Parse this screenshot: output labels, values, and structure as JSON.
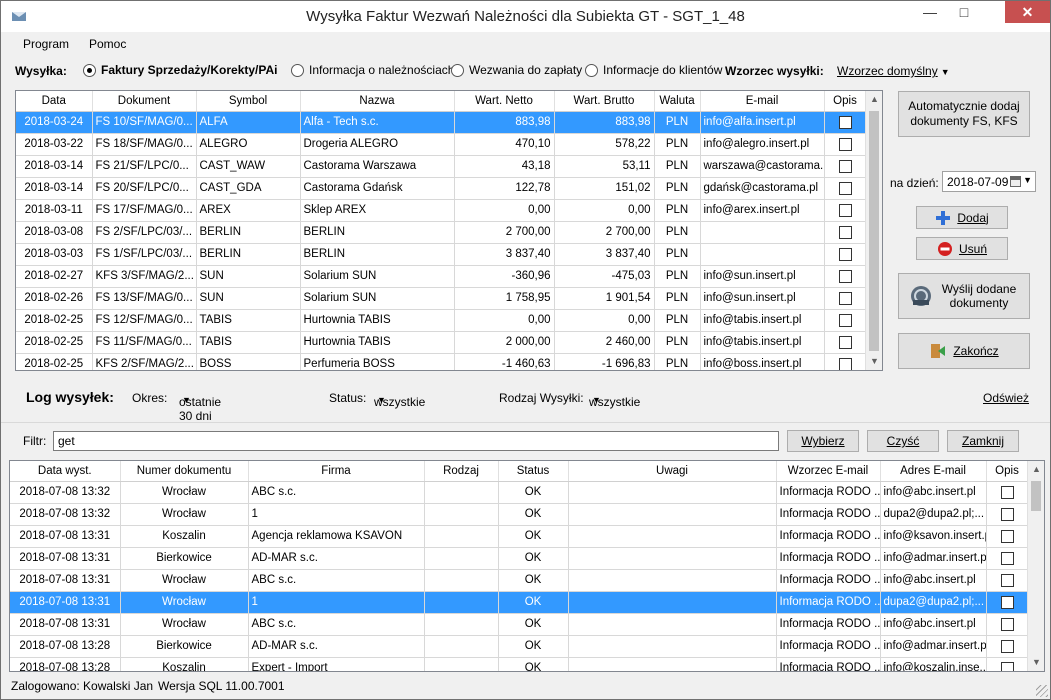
{
  "window": {
    "title": "Wysyłka Faktur Wezwań Należności dla Subiekta GT - SGT_1_48"
  },
  "menu": {
    "program": "Program",
    "pomoc": "Pomoc"
  },
  "wysylka": {
    "label": "Wysyłka:",
    "options": [
      "Faktury Sprzedaży/Korekty/PAi",
      "Informacja o należnościach",
      "Wezwania do zapłaty",
      "Informacje do klientów"
    ],
    "selected": 0,
    "wzorzec_label": "Wzorzec wysyłki:",
    "wzorzec_value": "Wzorzec domyślny"
  },
  "documents": {
    "columns": [
      "Data",
      "Dokument",
      "Symbol",
      "Nazwa",
      "Wart. Netto",
      "Wart. Brutto",
      "Waluta",
      "E-mail",
      "Opis"
    ],
    "rows": [
      [
        "2018-03-24",
        "FS 10/SF/MAG/0...",
        "ALFA",
        "Alfa - Tech s.c.",
        "883,98",
        "883,98",
        "PLN",
        "info@alfa.insert.pl"
      ],
      [
        "2018-03-22",
        "FS 18/SF/MAG/0...",
        "ALEGRO",
        "Drogeria ALEGRO",
        "470,10",
        "578,22",
        "PLN",
        "info@alegro.insert.pl"
      ],
      [
        "2018-03-14",
        "FS 21/SF/LPC/0...",
        "CAST_WAW",
        "Castorama Warszawa",
        "43,18",
        "53,11",
        "PLN",
        "warszawa@castorama..."
      ],
      [
        "2018-03-14",
        "FS 20/SF/LPC/0...",
        "CAST_GDA",
        "Castorama Gdańsk",
        "122,78",
        "151,02",
        "PLN",
        "gdańsk@castorama.pl"
      ],
      [
        "2018-03-11",
        "FS 17/SF/MAG/0...",
        "AREX",
        "Sklep AREX",
        "0,00",
        "0,00",
        "PLN",
        "info@arex.insert.pl"
      ],
      [
        "2018-03-08",
        "FS 2/SF/LPC/03/...",
        "BERLIN",
        "BERLIN",
        "2 700,00",
        "2 700,00",
        "PLN",
        ""
      ],
      [
        "2018-03-03",
        "FS 1/SF/LPC/03/...",
        "BERLIN",
        "BERLIN",
        "3 837,40",
        "3 837,40",
        "PLN",
        ""
      ],
      [
        "2018-02-27",
        "KFS 3/SF/MAG/2...",
        "SUN",
        "Solarium SUN",
        "-360,96",
        "-475,03",
        "PLN",
        "info@sun.insert.pl"
      ],
      [
        "2018-02-26",
        "FS 13/SF/MAG/0...",
        "SUN",
        "Solarium SUN",
        "1 758,95",
        "1 901,54",
        "PLN",
        "info@sun.insert.pl"
      ],
      [
        "2018-02-25",
        "FS 12/SF/MAG/0...",
        "TABIS",
        "Hurtownia TABIS",
        "0,00",
        "0,00",
        "PLN",
        "info@tabis.insert.pl"
      ],
      [
        "2018-02-25",
        "FS 11/SF/MAG/0...",
        "TABIS",
        "Hurtownia TABIS",
        "2 000,00",
        "2 460,00",
        "PLN",
        "info@tabis.insert.pl"
      ],
      [
        "2018-02-25",
        "KFS 2/SF/MAG/2...",
        "BOSS",
        "Perfumeria BOSS",
        "-1 460,63",
        "-1 696,83",
        "PLN",
        "info@boss.insert.pl"
      ]
    ],
    "selected_row": 0
  },
  "side": {
    "auto_add": "Automatycznie dodaj dokumenty FS, KFS",
    "na_dzien_label": "na dzień:",
    "date": "2018-07-09",
    "dodaj": "Dodaj",
    "usun": "Usuń",
    "wyslij": "Wyślij dodane dokumenty",
    "zakoncz": "Zakończ"
  },
  "log": {
    "title": "Log wysyłek:",
    "okres_label": "Okres:",
    "okres_value": "ostatnie 30 dni",
    "status_label": "Status:",
    "status_value": "wszystkie",
    "rodzaj_label": "Rodzaj Wysyłki:",
    "rodzaj_value": "wszystkie",
    "odswiez": "Odśwież"
  },
  "filter": {
    "label": "Filtr:",
    "value": "get",
    "wybierz": "Wybierz",
    "czysc": "Czyść",
    "zamknij": "Zamknij"
  },
  "logtable": {
    "columns": [
      "Data wyst.",
      "Numer dokumentu",
      "Firma",
      "Rodzaj",
      "Status",
      "Uwagi",
      "Wzorzec E-mail",
      "Adres E-mail",
      "Opis"
    ],
    "rows": [
      [
        "2018-07-08 13:32",
        "Wrocław",
        "ABC s.c.",
        "",
        "OK",
        "",
        "Informacja RODO ...",
        "info@abc.insert.pl"
      ],
      [
        "2018-07-08 13:32",
        "Wrocław",
        "1",
        "",
        "OK",
        "",
        "Informacja RODO ...",
        "dupa2@dupa2.pl;..."
      ],
      [
        "2018-07-08 13:31",
        "Koszalin",
        "Agencja reklamowa KSAVON",
        "",
        "OK",
        "",
        "Informacja RODO ...",
        "info@ksavon.insert.pl"
      ],
      [
        "2018-07-08 13:31",
        "Bierkowice",
        "AD-MAR s.c.",
        "",
        "OK",
        "",
        "Informacja RODO ...",
        "info@admar.insert.pl"
      ],
      [
        "2018-07-08 13:31",
        "Wrocław",
        "ABC s.c.",
        "",
        "OK",
        "",
        "Informacja RODO ...",
        "info@abc.insert.pl"
      ],
      [
        "2018-07-08 13:31",
        "Wrocław",
        "1",
        "",
        "OK",
        "",
        "Informacja RODO ...",
        "dupa2@dupa2.pl;..."
      ],
      [
        "2018-07-08 13:31",
        "Wrocław",
        "ABC s.c.",
        "",
        "OK",
        "",
        "Informacja RODO ...",
        "info@abc.insert.pl"
      ],
      [
        "2018-07-08 13:28",
        "Bierkowice",
        "AD-MAR s.c.",
        "",
        "OK",
        "",
        "Informacja RODO ...",
        "info@admar.insert.pl"
      ],
      [
        "2018-07-08 13:28",
        "Koszalin",
        "Expert - Import",
        "",
        "OK",
        "",
        "Informacja RODO ...",
        "info@koszalin.inse..."
      ]
    ],
    "selected_row": 5
  },
  "status": {
    "user": "Zalogowano: Kowalski Jan",
    "version": "Wersja SQL 11.00.7001"
  },
  "colors": {
    "selection": "#3399ff",
    "close_button": "#c75050"
  }
}
